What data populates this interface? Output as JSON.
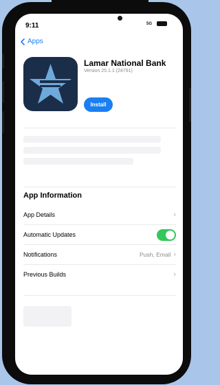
{
  "status": {
    "time": "9:11",
    "network": "5G"
  },
  "nav": {
    "back_label": "Apps"
  },
  "app": {
    "name": "Lamar National Bank",
    "version": "Version 25.1.1 (24791)",
    "install_label": "Install"
  },
  "info": {
    "title": "App Information",
    "rows": [
      {
        "label": "App Details",
        "value": ""
      },
      {
        "label": "Automatic Updates",
        "value": "",
        "toggle_on": true
      },
      {
        "label": "Notifications",
        "value": "Push, Email"
      },
      {
        "label": "Previous Builds",
        "value": ""
      }
    ]
  },
  "colors": {
    "accent": "#1a7ff2",
    "toggle": "#34c759",
    "icon_bg": "#1a2e4a",
    "background": "#a9c6ea"
  }
}
